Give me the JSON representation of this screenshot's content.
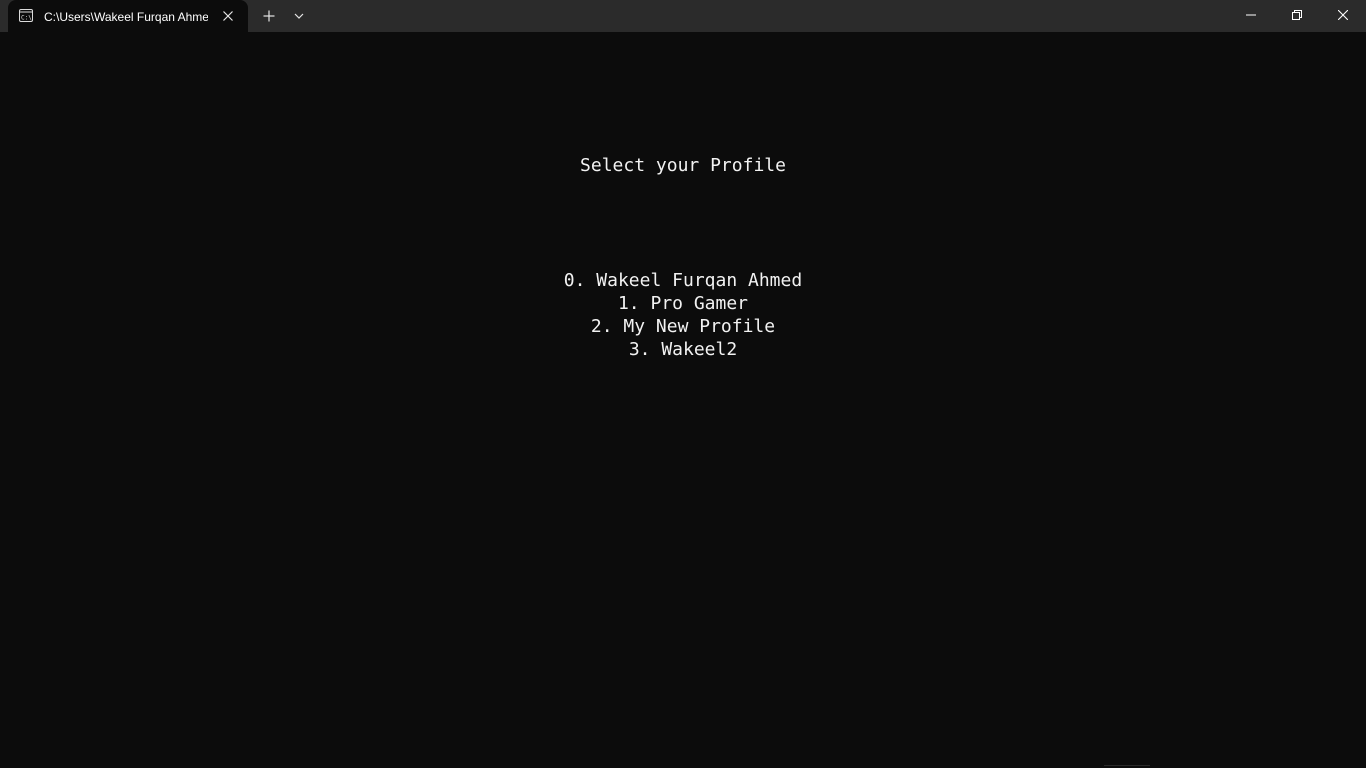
{
  "window": {
    "tab_title": "C:\\Users\\Wakeel Furqan Ahmed\\",
    "tab_icon": "terminal-icon"
  },
  "console": {
    "heading": "Select your Profile",
    "profiles": [
      "0. Wakeel Furqan Ahmed",
      "1. Pro Gamer",
      "2. My New Profile",
      "3. Wakeel2"
    ]
  },
  "colors": {
    "background": "#0c0c0c",
    "titlebar": "#2b2b2b",
    "text": "#f2f2f2"
  }
}
